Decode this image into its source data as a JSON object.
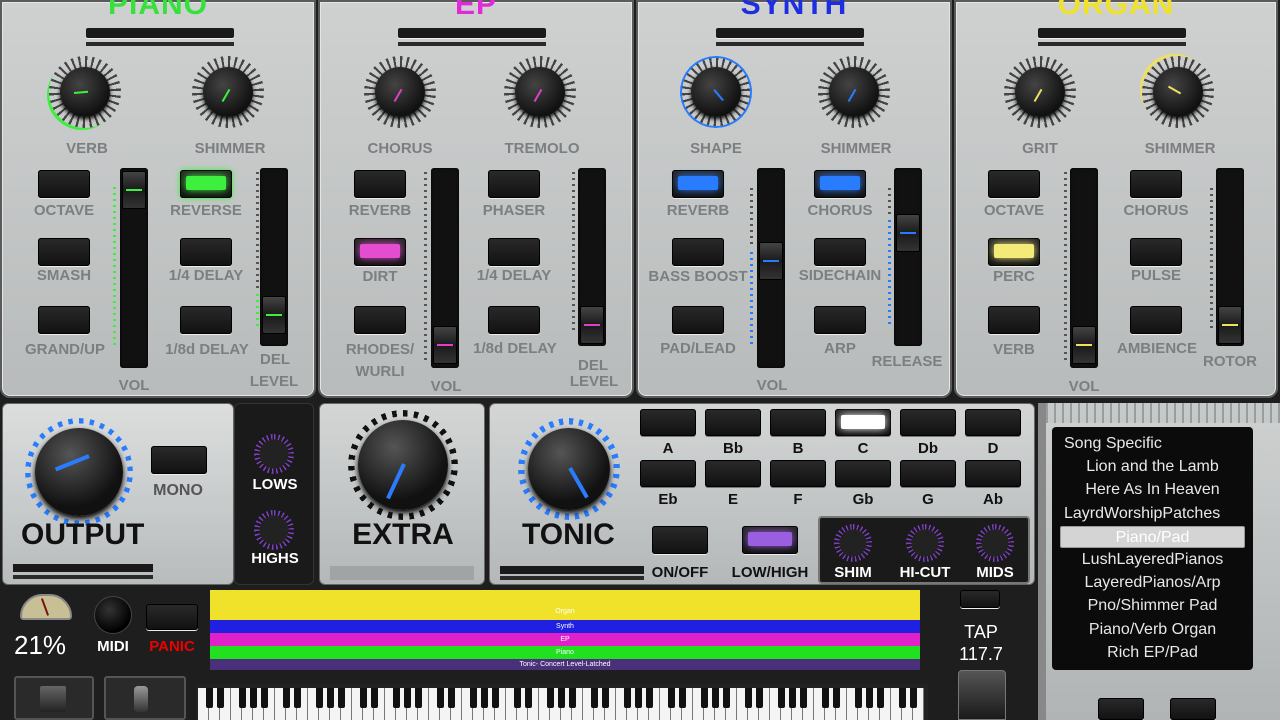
{
  "panels": [
    {
      "title": "PIANO",
      "title_color": "#36e13b",
      "accent": "#3ef03e",
      "knob1": "VERB",
      "knob2": "SHIMMER",
      "buttons": [
        "OCTAVE",
        "SMASH",
        "GRAND/UP",
        "REVERSE",
        "1/4 DELAY",
        "1/8d DELAY"
      ],
      "vol": "VOL",
      "del": "DEL",
      "level": "LEVEL"
    },
    {
      "title": "EP",
      "title_color": "#e02ad9",
      "accent": "#e040c8",
      "knob1": "CHORUS",
      "knob2": "TREMOLO",
      "buttons": [
        "REVERB",
        "DIRT",
        "RHODES/",
        "WURLI",
        "PHASER",
        "1/4 DELAY",
        "1/8d DELAY"
      ],
      "vol": "VOL",
      "del": "DEL",
      "level": "LEVEL"
    },
    {
      "title": "SYNTH",
      "title_color": "#1d2ee0",
      "accent": "#2a7cff",
      "knob1": "SHAPE",
      "knob2": "SHIMMER",
      "buttons": [
        "REVERB",
        "BASS BOOST",
        "PAD/LEAD",
        "CHORUS",
        "SIDECHAIN",
        "ARP"
      ],
      "vol": "VOL",
      "release": "RELEASE"
    },
    {
      "title": "ORGAN",
      "title_color": "#f0e22a",
      "accent": "#f0e060",
      "knob1": "GRIT",
      "knob2": "SHIMMER",
      "buttons": [
        "OCTAVE",
        "PERC",
        "VERB",
        "CHORUS",
        "PULSE",
        "AMBIENCE"
      ],
      "vol": "VOL",
      "rotor": "ROTOR"
    }
  ],
  "output": {
    "label": "OUTPUT",
    "mono": "MONO"
  },
  "eq": {
    "lows": "LOWS",
    "highs": "HIGHS"
  },
  "extra": {
    "label": "EXTRA"
  },
  "tonic": {
    "label": "TONIC",
    "onoff": "ON/OFF",
    "lowhigh": "LOW/HIGH",
    "notes": [
      "A",
      "Bb",
      "B",
      "C",
      "Db",
      "D",
      "Eb",
      "E",
      "F",
      "Gb",
      "G",
      "Ab"
    ],
    "selected_note": "C",
    "fx": [
      "SHIM",
      "HI-CUT",
      "MIDS"
    ]
  },
  "meter": {
    "percent": "21%",
    "midi": "MIDI",
    "panic": "PANIC"
  },
  "tap": {
    "label": "TAP",
    "bpm": "117.7"
  },
  "strips": [
    "Organ",
    "Synth",
    "EP",
    "Piano",
    "Tonic- Concert Level-Latched"
  ],
  "songs": [
    "Song Specific",
    "Lion and the Lamb",
    "Here As In Heaven",
    "LayrdWorshipPatches",
    "Piano/Pad",
    "LushLayeredPianos",
    "LayeredPianos/Arp",
    "Pno/Shimmer Pad",
    "Piano/Verb Organ",
    "Rich EP/Pad"
  ],
  "selected_song": "Piano/Pad"
}
